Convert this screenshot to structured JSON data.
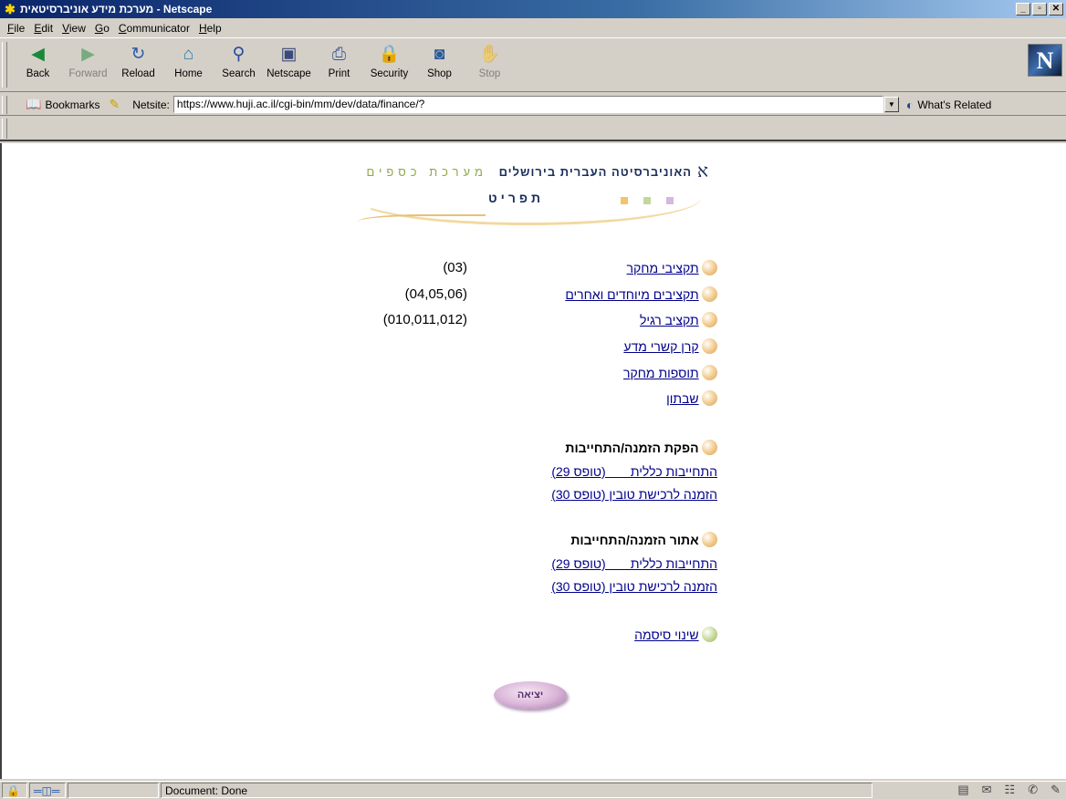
{
  "window": {
    "title": "מערכת מידע אוניברסיטאית - Netscape",
    "controls": {
      "minimize": "_",
      "maximize": "▫",
      "close": "✕"
    }
  },
  "menubar": [
    "File",
    "Edit",
    "View",
    "Go",
    "Communicator",
    "Help"
  ],
  "toolbar": [
    {
      "label": "Back",
      "icon": "back-icon",
      "glyph": "◀",
      "color": "#1a8a3a",
      "disabled": false
    },
    {
      "label": "Forward",
      "icon": "forward-icon",
      "glyph": "▶",
      "color": "#1a8a3a",
      "disabled": true
    },
    {
      "label": "Reload",
      "icon": "reload-icon",
      "glyph": "↻",
      "color": "#2a5aa8",
      "disabled": false
    },
    {
      "label": "Home",
      "icon": "home-icon",
      "glyph": "⌂",
      "color": "#2a7ab0",
      "disabled": false
    },
    {
      "label": "Search",
      "icon": "search-icon",
      "glyph": "⚲",
      "color": "#2a4a9a",
      "disabled": false
    },
    {
      "label": "Netscape",
      "icon": "netscape-icon",
      "glyph": "▣",
      "color": "#3a4a7a",
      "disabled": false
    },
    {
      "label": "Print",
      "icon": "print-icon",
      "glyph": "⎙",
      "color": "#3a5a9a",
      "disabled": false
    },
    {
      "label": "Security",
      "icon": "lock-icon",
      "glyph": "🔒",
      "color": "#c8a000",
      "disabled": false
    },
    {
      "label": "Shop",
      "icon": "shop-icon",
      "glyph": "◙",
      "color": "#2a5a9a",
      "disabled": false
    },
    {
      "label": "Stop",
      "icon": "stop-icon",
      "glyph": "✋",
      "color": "#a03030",
      "disabled": true
    }
  ],
  "location": {
    "bookmarks_label": "Bookmarks",
    "netsite_label": "Netsite:",
    "url": "https://www.huji.ac.il/cgi-bin/mm/dev/data/finance/?",
    "related_label": "What's Related"
  },
  "page": {
    "university_name": "האוניברסיטה העברית בירושלים",
    "system_name": "מערכת כספים",
    "menu_title": "תפריט",
    "accent_colors": [
      "#f2c46a",
      "#c4d79a",
      "#d4b8e0"
    ],
    "links": [
      {
        "label": "תקציבי מחקר",
        "code": "(03)"
      },
      {
        "label": "תקציבים מיוחדים ואחרים",
        "code": "(04,05,06)"
      },
      {
        "label": "תקציב רגיל",
        "code": "(010,011,012)"
      },
      {
        "label": "קרן קשרי מדע",
        "code": ""
      },
      {
        "label": "תוספות מחקר",
        "code": ""
      },
      {
        "label": "שבתון",
        "code": ""
      }
    ],
    "section_issue": {
      "title": "הפקת הזמנה/התחייבות",
      "items": [
        "התחייבות כללית       (טופס 29)",
        "הזמנה לרכישת טובין (טופס 30)"
      ]
    },
    "section_find": {
      "title": "אתור הזמנה/התחייבות",
      "items": [
        "התחייבות כללית       (טופס 29)",
        "הזמנה לרכישת טובין (טופס 30)"
      ]
    },
    "change_password": "שינוי סיסמה",
    "exit_button": "יציאה"
  },
  "status": {
    "text": "Document: Done"
  }
}
